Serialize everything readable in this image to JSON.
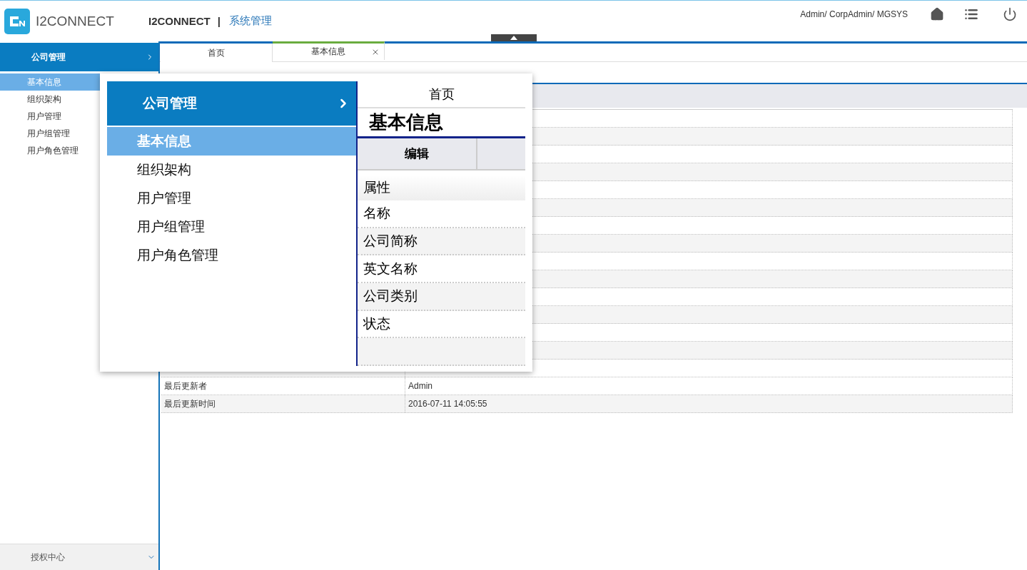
{
  "header": {
    "logo_text": "I2CONNECT",
    "app_name": "I2CONNECT",
    "separator": "|",
    "module": "系统管理",
    "user": "Admin/ CorpAdmin/ MGSYS"
  },
  "sidebar": {
    "group": "公司管理",
    "items": [
      {
        "label": "基本信息",
        "selected": true
      },
      {
        "label": "组织架构",
        "selected": false
      },
      {
        "label": "用户管理",
        "selected": false
      },
      {
        "label": "用户组管理",
        "selected": false
      },
      {
        "label": "用户角色管理",
        "selected": false
      }
    ],
    "footer": "授权中心"
  },
  "tabs": [
    {
      "label": "首页",
      "selected": false,
      "closable": false
    },
    {
      "label": "基本信息",
      "selected": true,
      "closable": true
    }
  ],
  "page": {
    "rows": [
      {
        "label": "最后更新者",
        "value": "Admin"
      },
      {
        "label": "最后更新时间",
        "value": "2016-07-11 14:05:55"
      }
    ]
  },
  "magnifier": {
    "group": "公司管理",
    "items": [
      {
        "label": "基本信息",
        "selected": true
      },
      {
        "label": "组织架构",
        "selected": false
      },
      {
        "label": "用户管理",
        "selected": false
      },
      {
        "label": "用户组管理",
        "selected": false
      },
      {
        "label": "用户角色管理",
        "selected": false
      }
    ],
    "tab": "首页",
    "title": "基本信息",
    "toolbar": [
      "编辑"
    ],
    "table_header": "属性",
    "rows": [
      "名称",
      "公司简称",
      "英文名称",
      "公司类别",
      "状态"
    ]
  }
}
